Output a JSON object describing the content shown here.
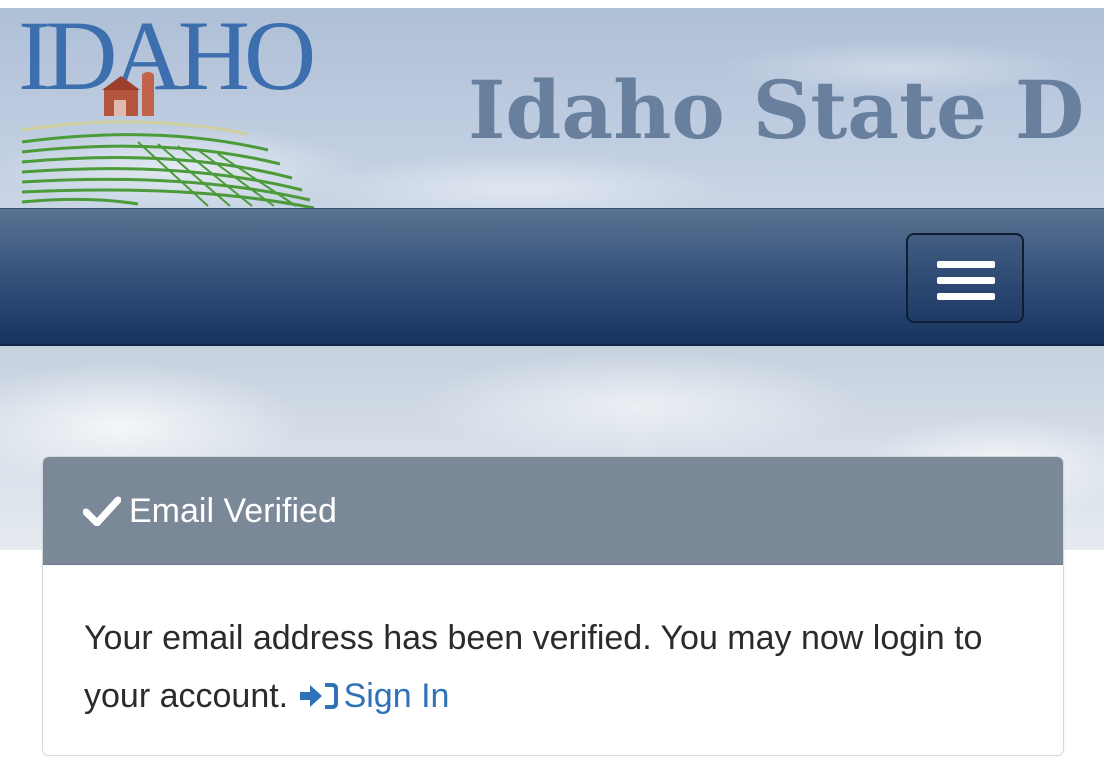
{
  "header": {
    "logo_text": "IDAHO",
    "site_title": "Idaho State D"
  },
  "navbar": {
    "menu_toggle_icon": "hamburger-menu-icon"
  },
  "alert": {
    "heading_icon": "checkmark-icon",
    "heading": "Email Verified",
    "message": "Your email address has been verified. You may now login to your account.",
    "link_icon": "sign-in-icon",
    "link_label": "Sign In"
  },
  "colors": {
    "navbar": "#223f6b",
    "panel_heading": "#7b8898",
    "link": "#2f72b6",
    "logo_blue": "#3d6fae",
    "title_gray_blue": "#687f9e"
  }
}
